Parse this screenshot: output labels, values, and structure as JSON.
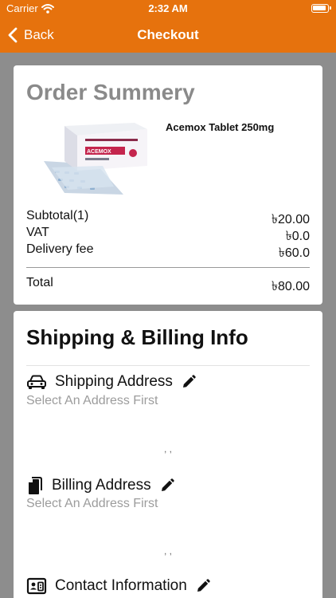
{
  "status_bar": {
    "carrier": "Carrier",
    "time": "2:32 AM"
  },
  "nav": {
    "back_label": "Back",
    "title": "Checkout"
  },
  "order_summary": {
    "title": "Order Summery",
    "product": {
      "name": "Acemox Tablet 250mg",
      "box_text": "ACEMOX"
    },
    "rows": [
      {
        "label": "Subtotal(1)",
        "value": "৳20.00"
      },
      {
        "label": "VAT",
        "value": "৳0.0"
      },
      {
        "label": "Delivery fee",
        "value": "৳60.0"
      }
    ],
    "total": {
      "label": "Total",
      "value": "৳80.00"
    }
  },
  "shipping_billing": {
    "title": "Shipping & Billing Info",
    "shipping": {
      "label": "Shipping Address",
      "placeholder": "Select An Address First",
      "detail": ", ,"
    },
    "billing": {
      "label": "Billing Address",
      "placeholder": "Select An Address First",
      "detail": ", ,"
    },
    "contact": {
      "label": "Contact Information"
    }
  },
  "colors": {
    "brand": "#e6720d",
    "background": "#8d8d8d",
    "muted_text": "#9c9c9c"
  }
}
